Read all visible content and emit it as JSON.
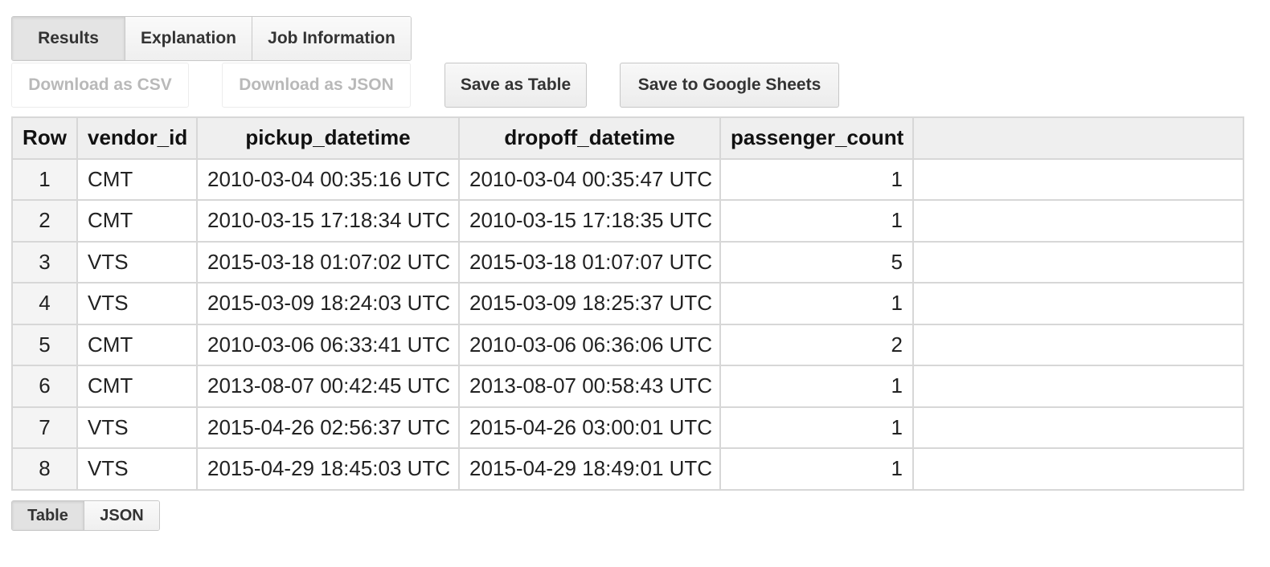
{
  "tabs": {
    "results": "Results",
    "explanation": "Explanation",
    "job_information": "Job Information"
  },
  "actions": {
    "download_csv": "Download as CSV",
    "download_json": "Download as JSON",
    "save_as_table": "Save as Table",
    "save_to_sheets": "Save to Google Sheets"
  },
  "table": {
    "headers": [
      "Row",
      "vendor_id",
      "pickup_datetime",
      "dropoff_datetime",
      "passenger_count"
    ],
    "rows": [
      {
        "row": "1",
        "vendor_id": "CMT",
        "pickup": "2010-03-04 00:35:16 UTC",
        "dropoff": "2010-03-04 00:35:47 UTC",
        "passengers": "1"
      },
      {
        "row": "2",
        "vendor_id": "CMT",
        "pickup": "2010-03-15 17:18:34 UTC",
        "dropoff": "2010-03-15 17:18:35 UTC",
        "passengers": "1"
      },
      {
        "row": "3",
        "vendor_id": "VTS",
        "pickup": "2015-03-18 01:07:02 UTC",
        "dropoff": "2015-03-18 01:07:07 UTC",
        "passengers": "5"
      },
      {
        "row": "4",
        "vendor_id": "VTS",
        "pickup": "2015-03-09 18:24:03 UTC",
        "dropoff": "2015-03-09 18:25:37 UTC",
        "passengers": "1"
      },
      {
        "row": "5",
        "vendor_id": "CMT",
        "pickup": "2010-03-06 06:33:41 UTC",
        "dropoff": "2010-03-06 06:36:06 UTC",
        "passengers": "2"
      },
      {
        "row": "6",
        "vendor_id": "CMT",
        "pickup": "2013-08-07 00:42:45 UTC",
        "dropoff": "2013-08-07 00:58:43 UTC",
        "passengers": "1"
      },
      {
        "row": "7",
        "vendor_id": "VTS",
        "pickup": "2015-04-26 02:56:37 UTC",
        "dropoff": "2015-04-26 03:00:01 UTC",
        "passengers": "1"
      },
      {
        "row": "8",
        "vendor_id": "VTS",
        "pickup": "2015-04-29 18:45:03 UTC",
        "dropoff": "2015-04-29 18:49:01 UTC",
        "passengers": "1"
      }
    ]
  },
  "views": {
    "table": "Table",
    "json": "JSON"
  }
}
